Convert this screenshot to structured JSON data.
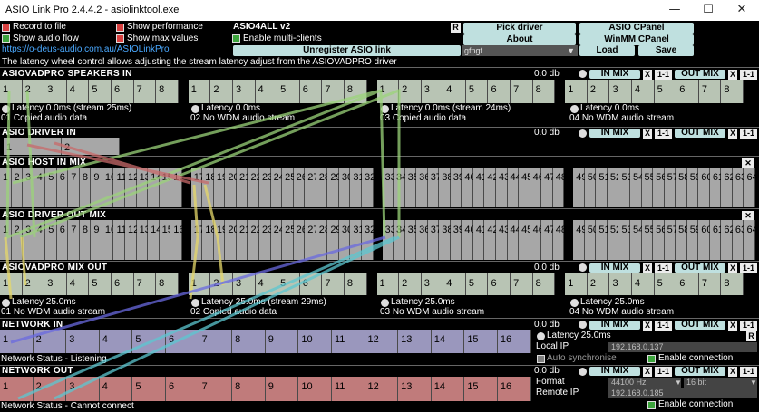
{
  "window": {
    "title": "ASIO Link Pro 2.4.4.2 - asiolinktool.exe",
    "min": "—",
    "max": "☐",
    "close": "✕"
  },
  "top": {
    "record": "Record to file",
    "show_audio_flow": "Show audio flow",
    "show_performance": "Show performance",
    "show_max_values": "Show max values",
    "driver_name": "ASIO4ALL v2",
    "multi_clients": "Enable multi-clients",
    "r": "R",
    "pick_driver": "Pick driver",
    "about": "About",
    "asio_cpanel": "ASIO CPanel",
    "winmm_cpanel": "WinMM CPanel",
    "unregister": "Unregister ASIO link",
    "preset": "gfngf",
    "load": "Load",
    "save": "Save",
    "url": "https://o-deus-audio.com.au/ASIOLinkPro",
    "hint": "The latency wheel control allows adjusting the stream latency adjust from the ASIOVADPRO driver"
  },
  "mix_buttons": {
    "in_mix": "IN MIX",
    "x": "X",
    "one": "1-1",
    "out_mix": "OUT MIX",
    "close": "✕"
  },
  "speakers_in": {
    "title": "ASIOVADPRO SPEAKERS IN",
    "db": "0.0 db",
    "groups": [
      {
        "latency": "Latency 0.0ms (stream 25ms)",
        "status": "01 Copied audio data"
      },
      {
        "latency": "Latency 0.0ms",
        "status": "02 No WDM audio stream"
      },
      {
        "latency": "Latency 0.0ms (stream 24ms)",
        "status": "03 Copied audio data"
      },
      {
        "latency": "Latency 0.0ms",
        "status": "04 No WDM audio stream"
      }
    ],
    "channels": [
      "1",
      "2",
      "3",
      "4",
      "5",
      "6",
      "7",
      "8"
    ]
  },
  "driver_in": {
    "title": "ASIO DRIVER IN",
    "db": "0.0 db",
    "channels": [
      "1",
      "2"
    ]
  },
  "host_in_mix": {
    "title": "ASIO HOST IN MIX",
    "channels": [
      "1",
      "2",
      "3",
      "4",
      "5",
      "6",
      "7",
      "8",
      "9",
      "10",
      "11",
      "12",
      "13",
      "14",
      "15",
      "16",
      "17",
      "18",
      "19",
      "20",
      "21",
      "22",
      "23",
      "24",
      "25",
      "26",
      "27",
      "28",
      "29",
      "30",
      "31",
      "32",
      "33",
      "34",
      "35",
      "36",
      "37",
      "38",
      "39",
      "40",
      "41",
      "42",
      "43",
      "44",
      "45",
      "46",
      "47",
      "48",
      "49",
      "50",
      "51",
      "52",
      "53",
      "54",
      "55",
      "56",
      "57",
      "58",
      "59",
      "60",
      "61",
      "62",
      "63",
      "64"
    ]
  },
  "driver_out_mix": {
    "title": "ASIO DRIVER OUT MIX"
  },
  "mix_out": {
    "title": "ASIOVADPRO MIX OUT",
    "db": "0.0 db",
    "groups": [
      {
        "latency": "Latency 25.0ms",
        "status": "01 No WDM audio stream"
      },
      {
        "latency": "Latency 25.0ms (stream 29ms)",
        "status": "02 Copied audio data"
      },
      {
        "latency": "Latency 25.0ms",
        "status": "03 No WDM audio stream"
      },
      {
        "latency": "Latency 25.0ms",
        "status": "04 No WDM audio stream"
      }
    ]
  },
  "network_in": {
    "title": "NETWORK IN",
    "db": "0.0 db",
    "latency": "Latency 25.0ms",
    "local_ip_label": "Local IP",
    "local_ip": "192.168.0.137",
    "auto_sync": "Auto synchronise",
    "enable_conn": "Enable connection",
    "status": "Network Status - Listening",
    "channels": [
      "1",
      "2",
      "3",
      "4",
      "5",
      "6",
      "7",
      "8",
      "9",
      "10",
      "11",
      "12",
      "13",
      "14",
      "15",
      "16"
    ]
  },
  "network_out": {
    "title": "NETWORK OUT",
    "db": "0.0 db",
    "format_label": "Format",
    "format": "44100 Hz",
    "bits": "16 bit",
    "remote_ip_label": "Remote IP",
    "remote_ip": "192.168.0.185",
    "enable_conn": "Enable connection",
    "status": "Network Status - Cannot connect",
    "channels": [
      "1",
      "2",
      "3",
      "4",
      "5",
      "6",
      "7",
      "8",
      "9",
      "10",
      "11",
      "12",
      "13",
      "14",
      "15",
      "16"
    ]
  }
}
